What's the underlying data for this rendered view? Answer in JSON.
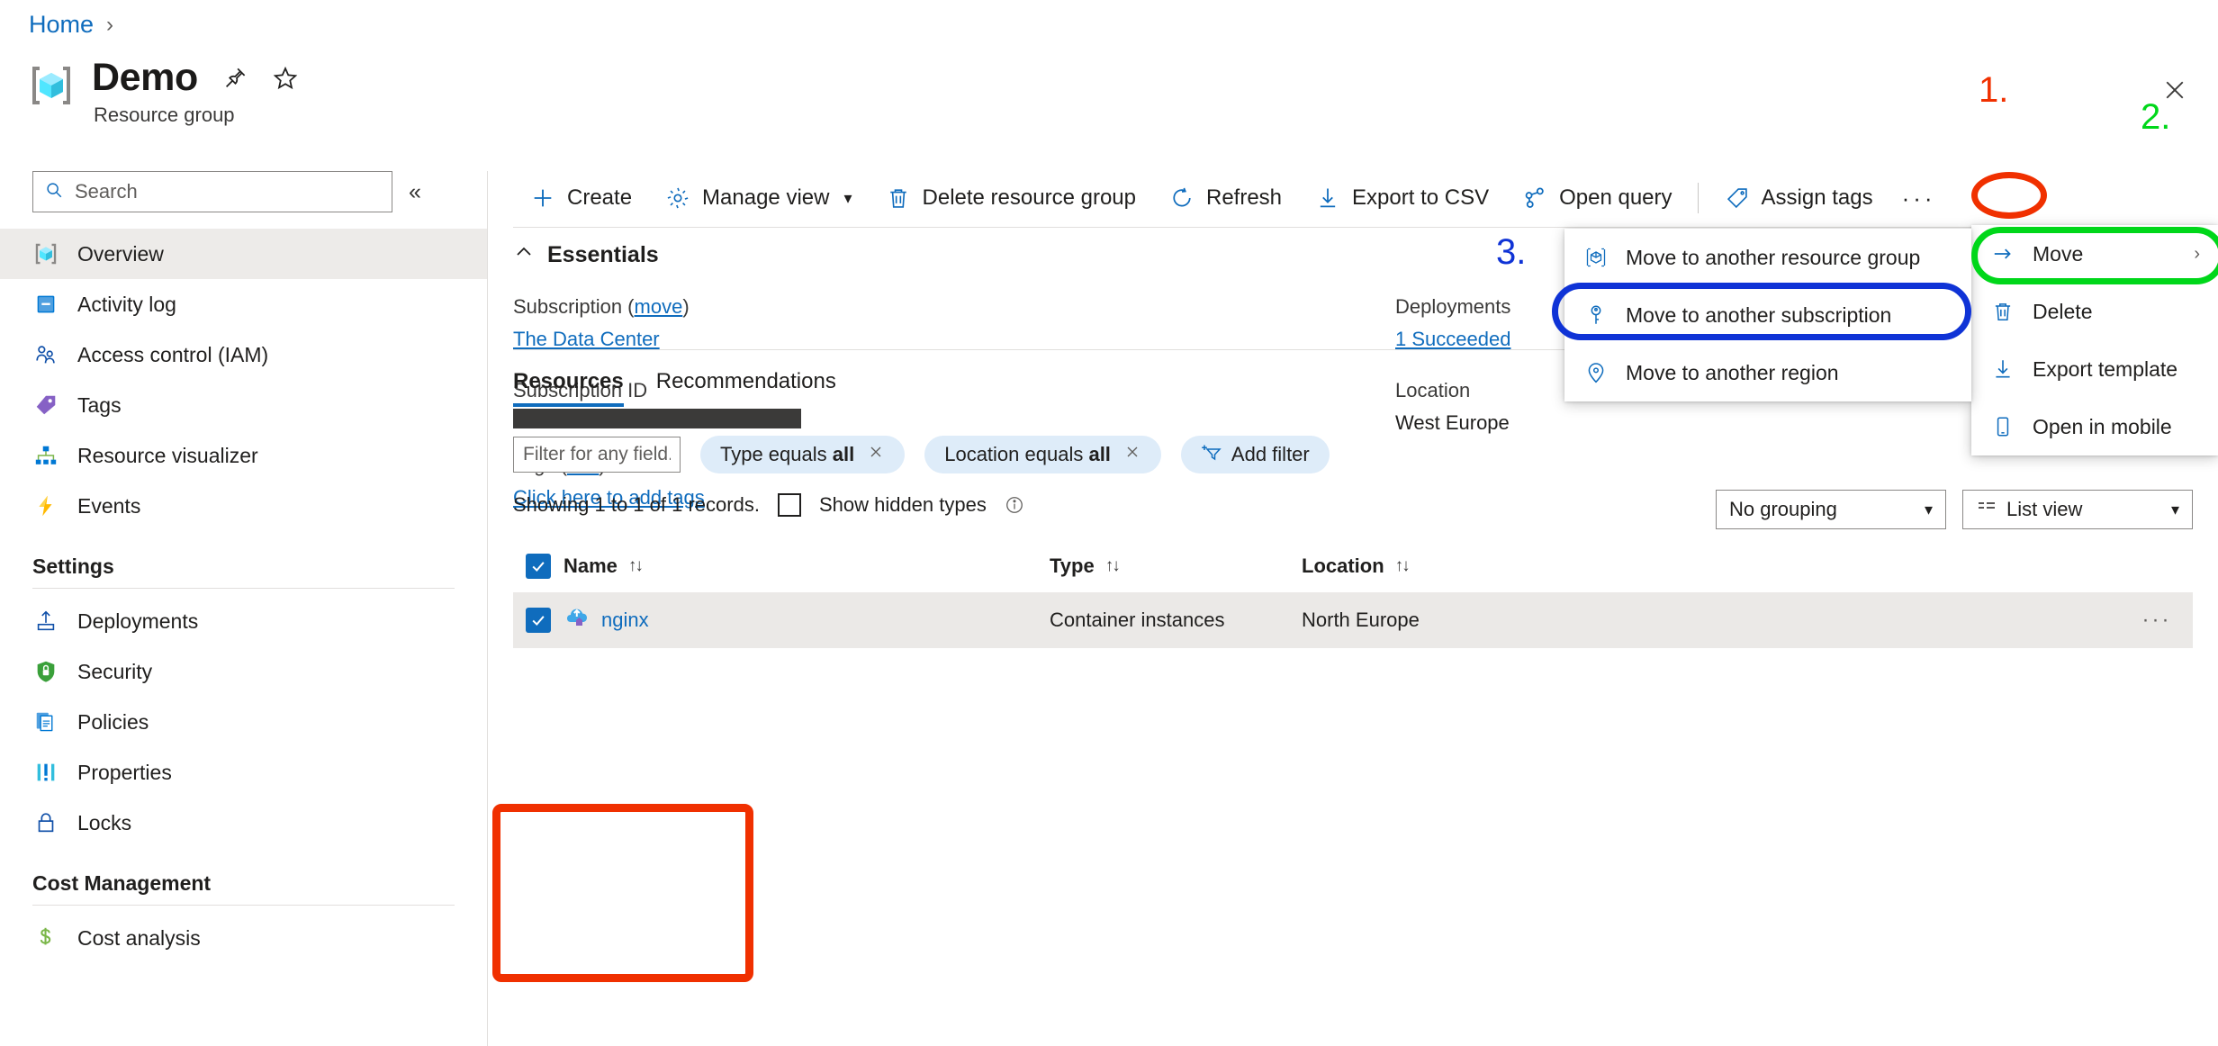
{
  "breadcrumb": {
    "home": "Home",
    "separator": "›"
  },
  "header": {
    "title": "Demo",
    "subtitle": "Resource group",
    "pin_icon": "pin-icon",
    "favorite_icon": "star-icon",
    "more_icon": "more-icon",
    "close_icon": "close-icon"
  },
  "sidebar": {
    "search_placeholder": "Search",
    "search_value": "",
    "collapse_label": "«",
    "items": [
      {
        "label": "Overview",
        "icon": "resource-group-icon",
        "active": true
      },
      {
        "label": "Activity log",
        "icon": "activity-log-icon",
        "active": false
      },
      {
        "label": "Access control (IAM)",
        "icon": "access-control-icon",
        "active": false
      },
      {
        "label": "Tags",
        "icon": "tags-icon",
        "active": false
      },
      {
        "label": "Resource visualizer",
        "icon": "resource-visualizer-icon",
        "active": false
      },
      {
        "label": "Events",
        "icon": "events-icon",
        "active": false
      }
    ],
    "groups": [
      {
        "label": "Settings",
        "items": [
          {
            "label": "Deployments",
            "icon": "deployments-icon"
          },
          {
            "label": "Security",
            "icon": "security-shield-icon"
          },
          {
            "label": "Policies",
            "icon": "policies-icon"
          },
          {
            "label": "Properties",
            "icon": "properties-icon"
          },
          {
            "label": "Locks",
            "icon": "lock-icon"
          }
        ]
      },
      {
        "label": "Cost Management",
        "items": [
          {
            "label": "Cost analysis",
            "icon": "cost-analysis-icon"
          }
        ]
      }
    ]
  },
  "toolbar": {
    "create": "Create",
    "manage_view": "Manage view",
    "delete_resource_group": "Delete resource group",
    "refresh": "Refresh",
    "export_to_csv": "Export to CSV",
    "open_query": "Open query",
    "assign_tags": "Assign tags",
    "more": "···"
  },
  "essentials": {
    "title": "Essentials",
    "subscription_label": "Subscription (",
    "subscription_move_link": "move",
    "subscription_label_close": ")",
    "subscription_value": "The Data Center",
    "subscription_id_label": "Subscription ID",
    "subscription_id_value": "",
    "tags_label": "Tags (",
    "tags_edit_link": "edit",
    "tags_label_close": ")",
    "tags_value": "Click here to add tags",
    "deployments_label": "Deployments",
    "deployments_value": "1 Succeeded",
    "location_label": "Location",
    "location_value": "West Europe"
  },
  "tabs": [
    {
      "label": "Resources",
      "active": true
    },
    {
      "label": "Recommendations",
      "active": false
    }
  ],
  "filters": {
    "input_placeholder": "Filter for any field...",
    "input_value": "",
    "pills": [
      {
        "prefix": "Type equals ",
        "value": "all"
      },
      {
        "prefix": "Location equals ",
        "value": "all"
      }
    ],
    "add_filter": "Add filter"
  },
  "records": {
    "showing_text": "Showing 1 to 1 of 1 records.",
    "show_hidden_types": "Show hidden types",
    "show_hidden_checked": false,
    "grouping": "No grouping",
    "view_mode": "List view"
  },
  "table": {
    "columns": [
      {
        "label": "Name",
        "sort": "↑↓"
      },
      {
        "label": "Type",
        "sort": "↑↓"
      },
      {
        "label": "Location",
        "sort": "↑↓"
      }
    ],
    "header_checked": true,
    "rows": [
      {
        "checked": true,
        "name": "nginx",
        "icon": "container-instance-icon",
        "type": "Container instances",
        "location": "North Europe",
        "more": "···"
      }
    ]
  },
  "menus": {
    "main": [
      {
        "label": "Move",
        "icon": "move-arrow-icon",
        "has_submenu": true,
        "submenu_arrow": "›"
      },
      {
        "label": "Delete",
        "icon": "trash-icon",
        "has_submenu": false
      },
      {
        "label": "Export template",
        "icon": "download-icon",
        "has_submenu": false
      },
      {
        "label": "Open in mobile",
        "icon": "mobile-icon",
        "has_submenu": false
      }
    ],
    "submenu": [
      {
        "label": "Move to another resource group",
        "icon": "resource-group-icon"
      },
      {
        "label": "Move to another subscription",
        "icon": "key-icon"
      },
      {
        "label": "Move to another region",
        "icon": "location-pin-icon"
      }
    ]
  },
  "annotations": {
    "step1": "1.",
    "step2": "2.",
    "step3": "3.",
    "color_red": "#f03000",
    "color_green": "#00d71a",
    "color_blue": "#0f33d6"
  }
}
